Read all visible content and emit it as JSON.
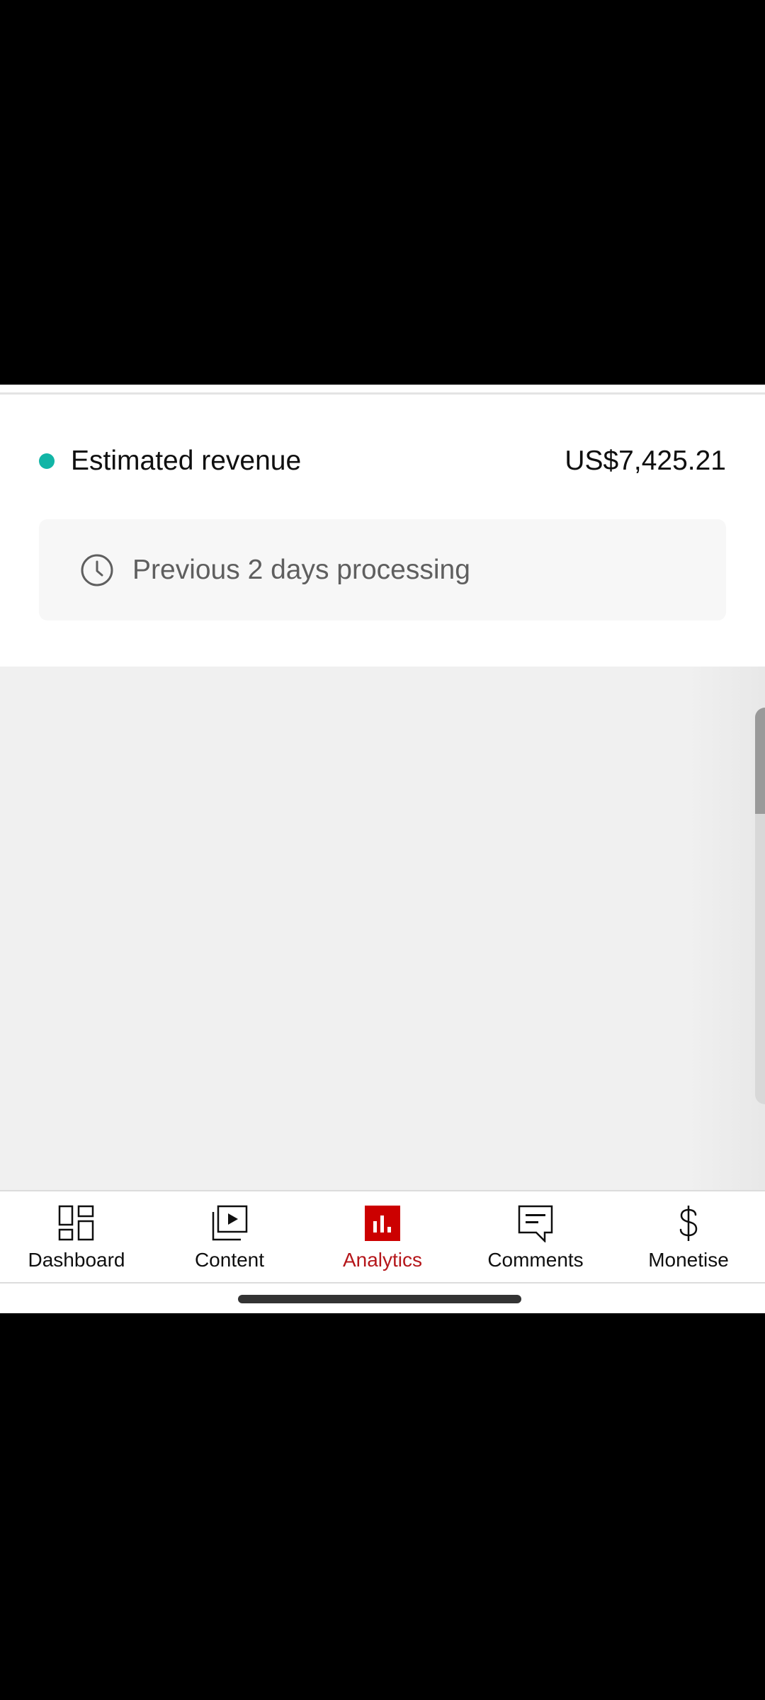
{
  "revenue": {
    "label": "Estimated revenue",
    "value": "US$7,425.21",
    "dot_color": "#12b5a6",
    "processing_note": "Previous 2 days processing",
    "note_icon": "clock-icon"
  },
  "bottom_nav": {
    "items": [
      {
        "label": "Dashboard",
        "icon": "dashboard-icon",
        "active": false
      },
      {
        "label": "Content",
        "icon": "content-icon",
        "active": false
      },
      {
        "label": "Analytics",
        "icon": "analytics-icon",
        "active": true
      },
      {
        "label": "Comments",
        "icon": "comments-icon",
        "active": false
      },
      {
        "label": "Monetise",
        "icon": "monetise-icon",
        "active": false
      }
    ],
    "active_color": "#b5171b"
  }
}
